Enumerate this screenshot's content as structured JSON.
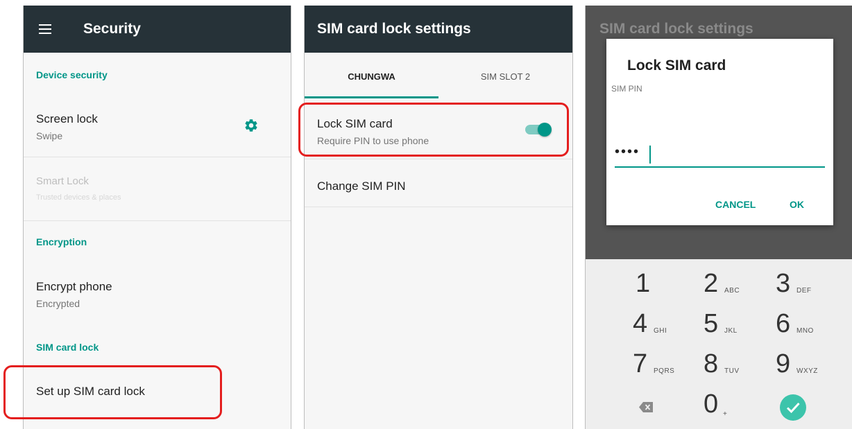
{
  "panel1": {
    "title": "Security",
    "sections": {
      "device_security": "Device security",
      "encryption": "Encryption",
      "sim_card_lock": "SIM card lock"
    },
    "screen_lock": {
      "title": "Screen lock",
      "sub": "Swipe"
    },
    "smart_lock": {
      "title": "Smart Lock",
      "sub": "Trusted devices & places"
    },
    "encrypt_phone": {
      "title": "Encrypt phone",
      "sub": "Encrypted"
    },
    "setup_sim_lock": "Set up SIM card lock"
  },
  "panel2": {
    "title": "SIM card lock settings",
    "tabs": [
      "CHUNGWA",
      "SIM SLOT 2"
    ],
    "lock_sim": {
      "title": "Lock SIM card",
      "sub": "Require PIN to use phone",
      "toggled_on": true
    },
    "change_pin": "Change SIM PIN"
  },
  "panel3": {
    "bg_title": "SIM card lock settings",
    "dialog": {
      "title": "Lock SIM card",
      "field_label": "SIM PIN",
      "pin_value": "••••",
      "cancel": "CANCEL",
      "ok": "OK"
    },
    "keypad": [
      {
        "num": "1",
        "letters": ""
      },
      {
        "num": "2",
        "letters": "ABC"
      },
      {
        "num": "3",
        "letters": "DEF"
      },
      {
        "num": "4",
        "letters": "GHI"
      },
      {
        "num": "5",
        "letters": "JKL"
      },
      {
        "num": "6",
        "letters": "MNO"
      },
      {
        "num": "7",
        "letters": "PQRS"
      },
      {
        "num": "8",
        "letters": "TUV"
      },
      {
        "num": "9",
        "letters": "WXYZ"
      },
      {
        "num": "0",
        "letters": "+"
      }
    ]
  },
  "colors": {
    "accent": "#009688",
    "appbar": "#263238",
    "highlight": "#e41e1e"
  }
}
